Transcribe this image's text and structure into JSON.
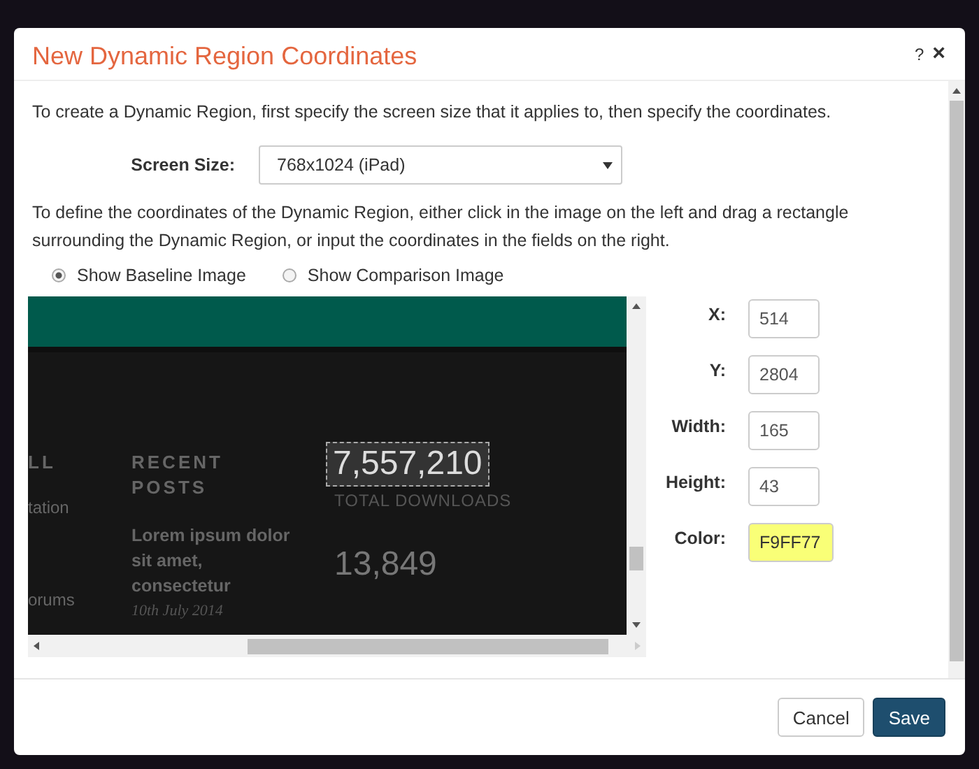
{
  "dialog": {
    "title": "New Dynamic Region Coordinates",
    "help": "?",
    "close": "×"
  },
  "intro": "To create a Dynamic Region, first specify the screen size that it applies to, then specify the coordinates.",
  "screen_size": {
    "label": "Screen Size:",
    "value": "768x1024 (iPad)"
  },
  "instructions": "To define the coordinates of the Dynamic Region, either click in the image on the left and drag a rectangle surrounding the Dynamic Region, or input the coordinates in the fields on the right.",
  "image_options": [
    {
      "label": "Show Baseline Image",
      "selected": true
    },
    {
      "label": "Show Comparison Image",
      "selected": false
    }
  ],
  "preview": {
    "left_column": [
      "LL",
      "tation",
      "orums"
    ],
    "heading": "RECENT POSTS",
    "post_title": "Lorem ipsum dolor sit amet, consectetur",
    "post_date": "10th July 2014",
    "stat_value": "7,557,210",
    "stat_label": "TOTAL DOWNLOADS",
    "stat_value_2": "13,849",
    "region_selected": true
  },
  "fields": [
    {
      "label": "X:",
      "value": "514",
      "kind": "number"
    },
    {
      "label": "Y:",
      "value": "2804",
      "kind": "number"
    },
    {
      "label": "Width:",
      "value": "165",
      "kind": "number"
    },
    {
      "label": "Height:",
      "value": "43",
      "kind": "number"
    },
    {
      "label": "Color:",
      "value": "F9FF77",
      "kind": "color",
      "color": "#f9ff77"
    }
  ],
  "buttons": [
    {
      "label": "Cancel",
      "kind": "default"
    },
    {
      "label": "Save",
      "kind": "primary"
    }
  ]
}
